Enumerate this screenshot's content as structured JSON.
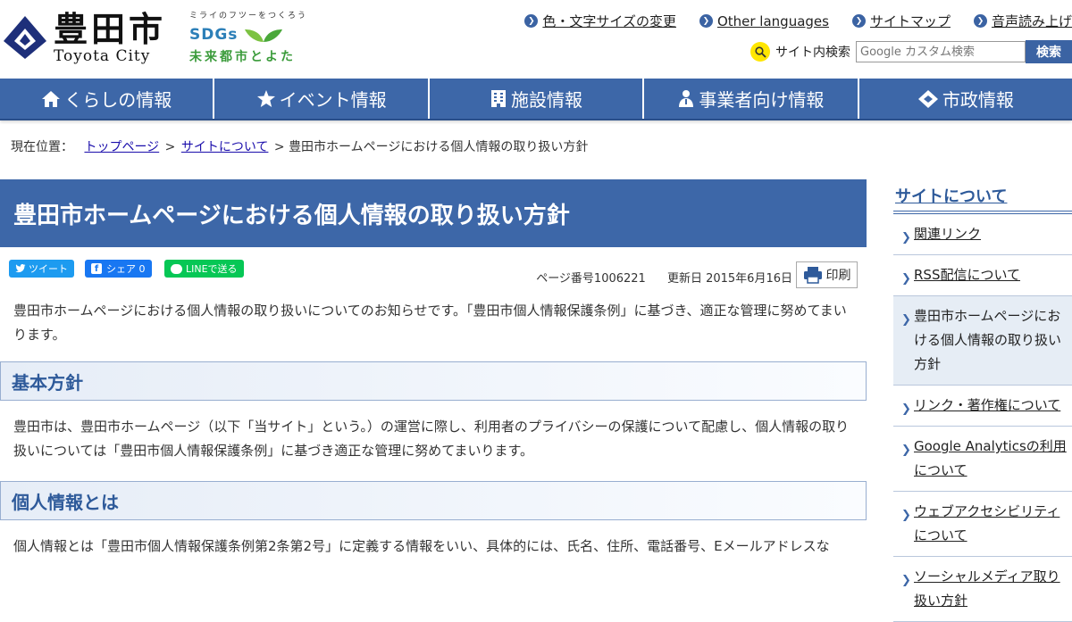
{
  "header": {
    "logo_jp": "豊田市",
    "logo_en": "Toyota City",
    "sdgs_tagline": "ミライのフツーをつくろう",
    "sdgs_word": "SDGs",
    "sdgs_sub": "未来都市とよた",
    "util_links": [
      {
        "label": "色・文字サイズの変更"
      },
      {
        "label": "Other languages"
      },
      {
        "label": "サイトマップ"
      },
      {
        "label": "音声読み上げ"
      }
    ],
    "search": {
      "label": "サイト内検索",
      "placeholder": "Google カスタム検索",
      "button": "検索"
    }
  },
  "nav": {
    "items": [
      {
        "label": "くらしの情報",
        "icon": "home-icon"
      },
      {
        "label": "イベント情報",
        "icon": "star-icon"
      },
      {
        "label": "施設情報",
        "icon": "building-icon"
      },
      {
        "label": "事業者向け情報",
        "icon": "person-icon"
      },
      {
        "label": "市政情報",
        "icon": "city-emblem-icon"
      }
    ]
  },
  "breadcrumb": {
    "prefix": "現在位置：",
    "links": [
      "トップページ",
      "サイトについて"
    ],
    "current": "豊田市ホームページにおける個人情報の取り扱い方針",
    "separator": ">"
  },
  "main": {
    "title": "豊田市ホームページにおける個人情報の取り扱い方針",
    "share": {
      "tweet": "ツイート",
      "facebook": "シェア 0",
      "line": "LINEで送る"
    },
    "page_number": "ページ番号1006221",
    "updated": "更新日 2015年6月16日",
    "print": "印刷",
    "intro": "豊田市ホームページにおける個人情報の取り扱いについてのお知らせです。「豊田市個人情報保護条例」に基づき、適正な管理に努めてまいります。",
    "sections": [
      {
        "heading": "基本方針",
        "body": "豊田市は、豊田市ホームページ（以下「当サイト」という。）の運営に際し、利用者のプライバシーの保護について配慮し、個人情報の取り扱いについては「豊田市個人情報保護条例」に基づき適正な管理に努めてまいります。"
      },
      {
        "heading": "個人情報とは",
        "body": "個人情報とは「豊田市個人情報保護条例第2条第2号」に定義する情報をいい、具体的には、氏名、住所、電話番号、Eメールアドレスな"
      }
    ]
  },
  "sidebar": {
    "title": "サイトについて",
    "items": [
      {
        "label": "関連リンク"
      },
      {
        "label": "RSS配信について"
      },
      {
        "label": "豊田市ホームページにおける個人情報の取り扱い方針"
      },
      {
        "label": "リンク・著作権について"
      },
      {
        "label": "Google Analyticsの利用について"
      },
      {
        "label": "ウェブアクセシビリティについて"
      },
      {
        "label": "ソーシャルメディア取り扱い方針"
      }
    ]
  },
  "colors": {
    "primary": "#3d67a8",
    "heading_text": "#2e5a9a",
    "sdgs_green": "#3a9b3a"
  }
}
